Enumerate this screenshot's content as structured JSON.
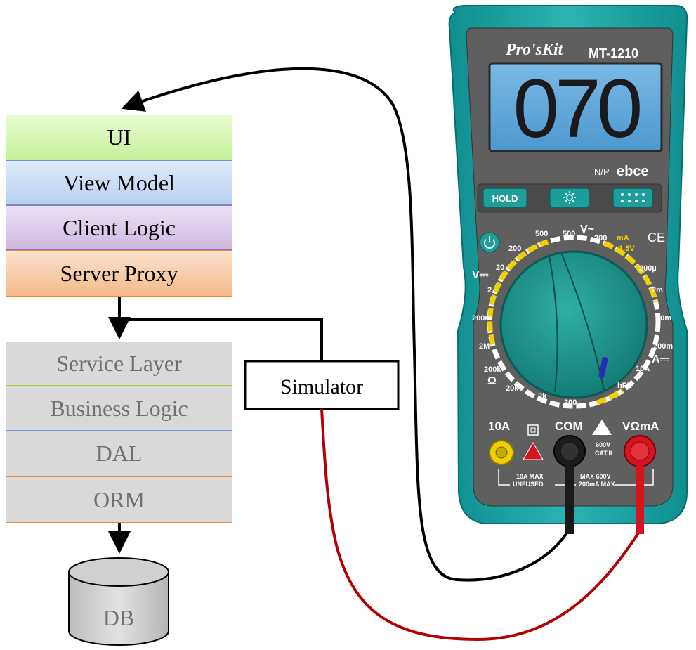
{
  "client_stack": [
    {
      "label": "UI",
      "color": "#cdf5a0",
      "border": "#9acd32"
    },
    {
      "label": "View Model",
      "color": "#c3d7f4",
      "border": "#6a93d4"
    },
    {
      "label": "Client Logic",
      "color": "#d6c4e6",
      "border": "#9572b8"
    },
    {
      "label": "Server Proxy",
      "color": "#f7c8a2",
      "border": "#e58a3c"
    }
  ],
  "server_stack": [
    {
      "label": "Service Layer",
      "color": "#d9d9d9",
      "border": "#9acd32"
    },
    {
      "label": "Business Logic",
      "color": "#d9d9d9",
      "border": "#6a93d4"
    },
    {
      "label": "DAL",
      "color": "#d9d9d9",
      "border": "#9572b8"
    },
    {
      "label": "ORM",
      "color": "#d9d9d9",
      "border": "#e58a3c"
    }
  ],
  "database": {
    "label": "DB"
  },
  "simulator": {
    "label": "Simulator"
  },
  "multimeter": {
    "brand": "Pro'sKit",
    "model": "MT-1210",
    "display_value": "070",
    "np_label": "N/P",
    "np_code": "ebce",
    "hold_label": "HOLD",
    "ranges": {
      "v500": "500",
      "v200": "200",
      "v20": "20",
      "v2": "2",
      "v200m": "200m",
      "ohm2M": "2M",
      "ohm200k": "200k",
      "ohm20k": "20k",
      "ohm2k": "2k",
      "ohm200": "200",
      "ac500": "500",
      "ac200": "200",
      "ma15": "mA",
      "ma15v": "1.5V",
      "a200u": "200µ",
      "a2m": "2m",
      "a20m": "20m",
      "a200m": "200m",
      "a10A": "10A",
      "hfe": "hFE"
    },
    "symbols": {
      "vdc": "V⎓",
      "vac": "V~",
      "ohm": "Ω",
      "adc": "A⎓",
      "ce": "CE"
    },
    "ports": {
      "p10a": "10A",
      "com": "COM",
      "vohm": "VΩmA",
      "max10a": "10A MAX",
      "unfused": "UNFUSED",
      "max600": "MAX 600V",
      "max200ma": "200mA MAX",
      "cat_v": "600V",
      "cat": "CAT.II"
    }
  },
  "colors": {
    "meter_body": "#1b9a9b",
    "meter_face": "#5f5f5f",
    "lcd": "#5ba5d8",
    "yellow": "#f0d000",
    "red_probe": "#d4141e",
    "black_probe": "#111111",
    "red_wire": "#b30000"
  }
}
